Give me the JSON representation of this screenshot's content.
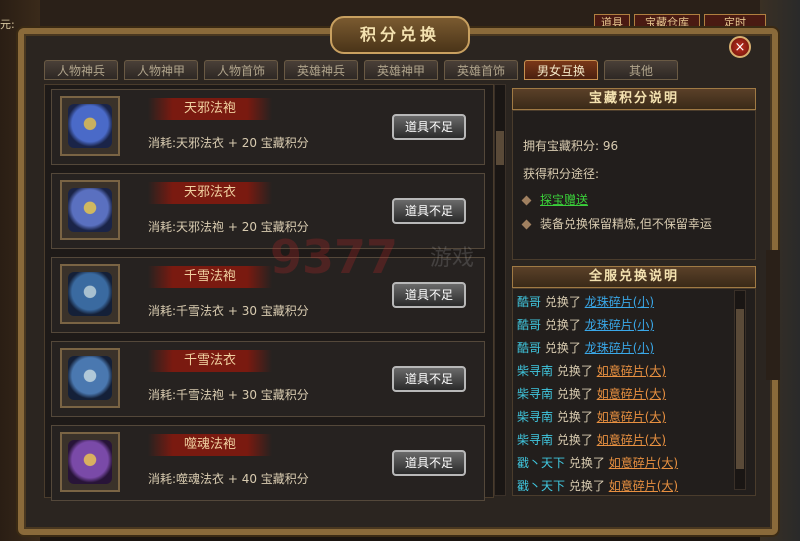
{
  "window": {
    "title": "积分兑换",
    "close_glyph": "×"
  },
  "top_bar": {
    "left_fragment": "元:",
    "buttons": [
      "道具",
      "宝藏仓库",
      "定时"
    ]
  },
  "tabs": [
    {
      "label": "人物神兵",
      "active": false
    },
    {
      "label": "人物神甲",
      "active": false
    },
    {
      "label": "人物首饰",
      "active": false
    },
    {
      "label": "英雄神兵",
      "active": false
    },
    {
      "label": "英雄神甲",
      "active": false
    },
    {
      "label": "英雄首饰",
      "active": false
    },
    {
      "label": "男女互换",
      "active": true
    },
    {
      "label": "其他",
      "active": false
    }
  ],
  "items": [
    {
      "name": "天邪法袍",
      "cost": "消耗:天邪法衣 + 20 宝藏积分",
      "button": "道具不足",
      "icon": "robe-icon",
      "color": "#4a6ac8"
    },
    {
      "name": "天邪法衣",
      "cost": "消耗:天邪法袍 + 20 宝藏积分",
      "button": "道具不足",
      "icon": "robe-icon",
      "color": "#5a70c0"
    },
    {
      "name": "千雪法袍",
      "cost": "消耗:千雪法衣 + 30 宝藏积分",
      "button": "道具不足",
      "icon": "robe-icon",
      "color": "#3a6aa0"
    },
    {
      "name": "千雪法衣",
      "cost": "消耗:千雪法袍 + 30 宝藏积分",
      "button": "道具不足",
      "icon": "robe-icon",
      "color": "#4a78b0"
    },
    {
      "name": "噬魂法袍",
      "cost": "消耗:噬魂法衣 + 40 宝藏积分",
      "button": "道具不足",
      "icon": "robe-icon",
      "color": "#7a4aa8"
    }
  ],
  "treasure_info": {
    "heading": "宝藏积分说明",
    "points_label": "拥有宝藏积分:",
    "points_value": "96",
    "ways_label": "获得积分途径:",
    "way1": "探宝赠送",
    "way2": "装备兑换保留精炼,但不保留幸运"
  },
  "server_log": {
    "heading": "全服兑换说明",
    "rows": [
      {
        "player": "酷哥",
        "verb": "兑换了",
        "item": "龙珠碎片(小)",
        "style": "blue"
      },
      {
        "player": "酷哥",
        "verb": "兑换了",
        "item": "龙珠碎片(小)",
        "style": "blue"
      },
      {
        "player": "酷哥",
        "verb": "兑换了",
        "item": "龙珠碎片(小)",
        "style": "blue"
      },
      {
        "player": "柴寻南",
        "verb": "兑换了",
        "item": "如意碎片(大)",
        "style": "orange"
      },
      {
        "player": "柴寻南",
        "verb": "兑换了",
        "item": "如意碎片(大)",
        "style": "orange"
      },
      {
        "player": "柴寻南",
        "verb": "兑换了",
        "item": "如意碎片(大)",
        "style": "orange"
      },
      {
        "player": "柴寻南",
        "verb": "兑换了",
        "item": "如意碎片(大)",
        "style": "orange"
      },
      {
        "player": "戳丶天下",
        "verb": "兑换了",
        "item": "如意碎片(大)",
        "style": "orange"
      },
      {
        "player": "戳丶天下",
        "verb": "兑换了",
        "item": "如意碎片(大)",
        "style": "orange"
      }
    ]
  },
  "watermark": {
    "number": "9377",
    "text": "游戏"
  }
}
